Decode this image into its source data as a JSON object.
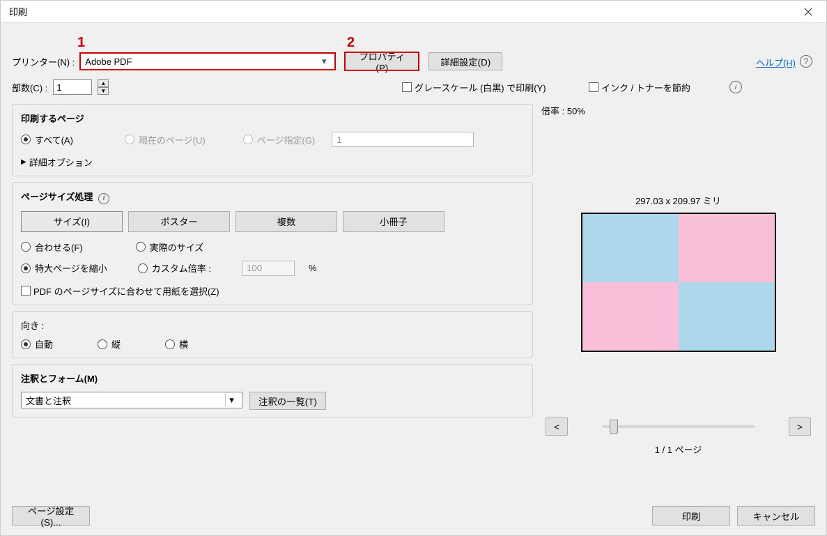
{
  "titlebar": {
    "title": "印刷"
  },
  "annotations": {
    "n1": "1",
    "n2": "2"
  },
  "printer": {
    "label": "プリンター(N) :",
    "value": "Adobe PDF",
    "properties_btn": "プロパティ(P)",
    "advanced_btn": "詳細設定(D)"
  },
  "help_link": "ヘルプ(H)",
  "copies": {
    "label": "部数(C) :",
    "value": "1"
  },
  "grayscale_label": "グレースケール (白黒) で印刷(Y)",
  "save_ink_label": "インク / トナーを節約",
  "pages": {
    "title": "印刷するページ",
    "all": "すべて(A)",
    "current": "現在のページ(U)",
    "range": "ページ指定(G)",
    "range_value": "1",
    "detail": "詳細オプション"
  },
  "sizing": {
    "title": "ページサイズ処理",
    "size_btn": "サイズ(I)",
    "poster_btn": "ポスター",
    "multi_btn": "複数",
    "booklet_btn": "小冊子",
    "fit": "合わせる(F)",
    "actual": "実際のサイズ",
    "shrink": "特大ページを縮小",
    "custom": "カスタム倍率 :",
    "custom_value": "100",
    "percent": "%",
    "pdf_size_chk": "PDF のページサイズに合わせて用紙を選択(Z)"
  },
  "orientation": {
    "title": "向き :",
    "auto": "自動",
    "portrait": "縦",
    "landscape": "横"
  },
  "comments": {
    "title": "注釈とフォーム(M)",
    "value": "文書と注釈",
    "list_btn": "注釈の一覧(T)"
  },
  "preview": {
    "scale_label": "倍率 : 50%",
    "dims": "297.03 x 209.97 ミリ",
    "prev": "<",
    "next": ">",
    "page_info": "1 / 1 ページ"
  },
  "bottom": {
    "page_setup": "ページ設定(S)...",
    "print": "印刷",
    "cancel": "キャンセル"
  }
}
